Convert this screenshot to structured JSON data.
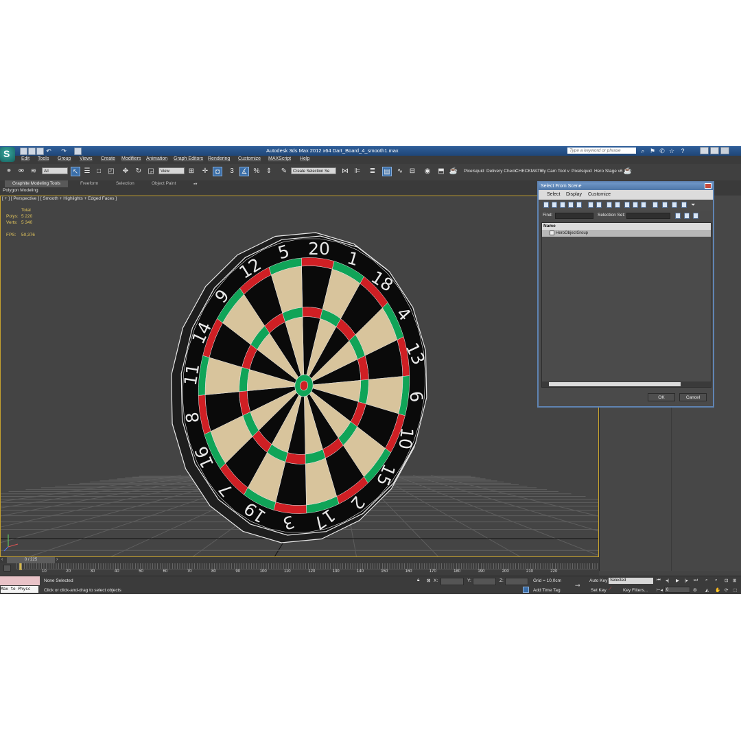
{
  "window": {
    "title": "Autodesk 3ds Max  2012 x64      Dart_Board_4_smooth1.max",
    "search_placeholder": "Type a keyword or phrase"
  },
  "menu": [
    "Edit",
    "Tools",
    "Group",
    "Views",
    "Create",
    "Modifiers",
    "Animation",
    "Graph Editors",
    "Rendering",
    "Customize",
    "MAXScript",
    "Help"
  ],
  "toolbar": {
    "selection_filter": "All",
    "coord_system": "View",
    "selection_set": "Create Selection Se",
    "plugins": [
      "Pixelsquid",
      "Delivery Check",
      "CHECKMATE",
      "uty Cam Tool v",
      "Pixelsquid",
      "Hero Stage v6"
    ]
  },
  "ribbon": {
    "tabs": [
      "Graphite Modeling Tools",
      "Freeform",
      "Selection",
      "Object Paint"
    ],
    "panel": "Polygon Modeling"
  },
  "viewport": {
    "label": "[ + ] [ Perspective ] [ Smooth + Highlights + Edged Faces ]",
    "stats_header": "Total",
    "polys_label": "Polys:",
    "polys": "5 220",
    "verts_label": "Verts:",
    "verts": "5 340",
    "fps_label": "FPS:",
    "fps": "50,376",
    "dartboard_numbers": [
      "20",
      "1",
      "18",
      "4",
      "13",
      "6",
      "10",
      "15",
      "2",
      "17",
      "3",
      "19",
      "7",
      "16",
      "8",
      "11",
      "14",
      "9",
      "12",
      "5"
    ],
    "colors": {
      "black": "#0a0a0a",
      "cream": "#d8c49c",
      "red": "#cf1f24",
      "green": "#10a458",
      "wire": "#e8e8e8",
      "grid": "#5e5e5e"
    }
  },
  "timeline": {
    "position": "0 / 225",
    "ticks": [
      "10",
      "20",
      "30",
      "40",
      "50",
      "60",
      "70",
      "80",
      "90",
      "100",
      "110",
      "120",
      "130",
      "140",
      "150",
      "160",
      "170",
      "180",
      "190",
      "200",
      "210",
      "220"
    ]
  },
  "status": {
    "maxscript": "Max to Physc",
    "selection": "None Selected",
    "prompt": "Click or click-and-drag to select objects",
    "x_label": "X:",
    "y_label": "Y:",
    "z_label": "Z:",
    "grid": "Grid = 10,0cm",
    "add_time_tag": "Add Time Tag",
    "auto_key": "Auto Key",
    "set_key": "Set Key",
    "key_mode": "Selected",
    "key_filters": "Key Filters...",
    "frame": "0"
  },
  "dialog": {
    "title": "Select From Scene",
    "menus": [
      "Select",
      "Display",
      "Customize"
    ],
    "find_label": "Find:",
    "selection_set_label": "Selection Set:",
    "column_name": "Name",
    "items": [
      "HeroObjectGroup"
    ],
    "ok": "OK",
    "cancel": "Cancel"
  }
}
